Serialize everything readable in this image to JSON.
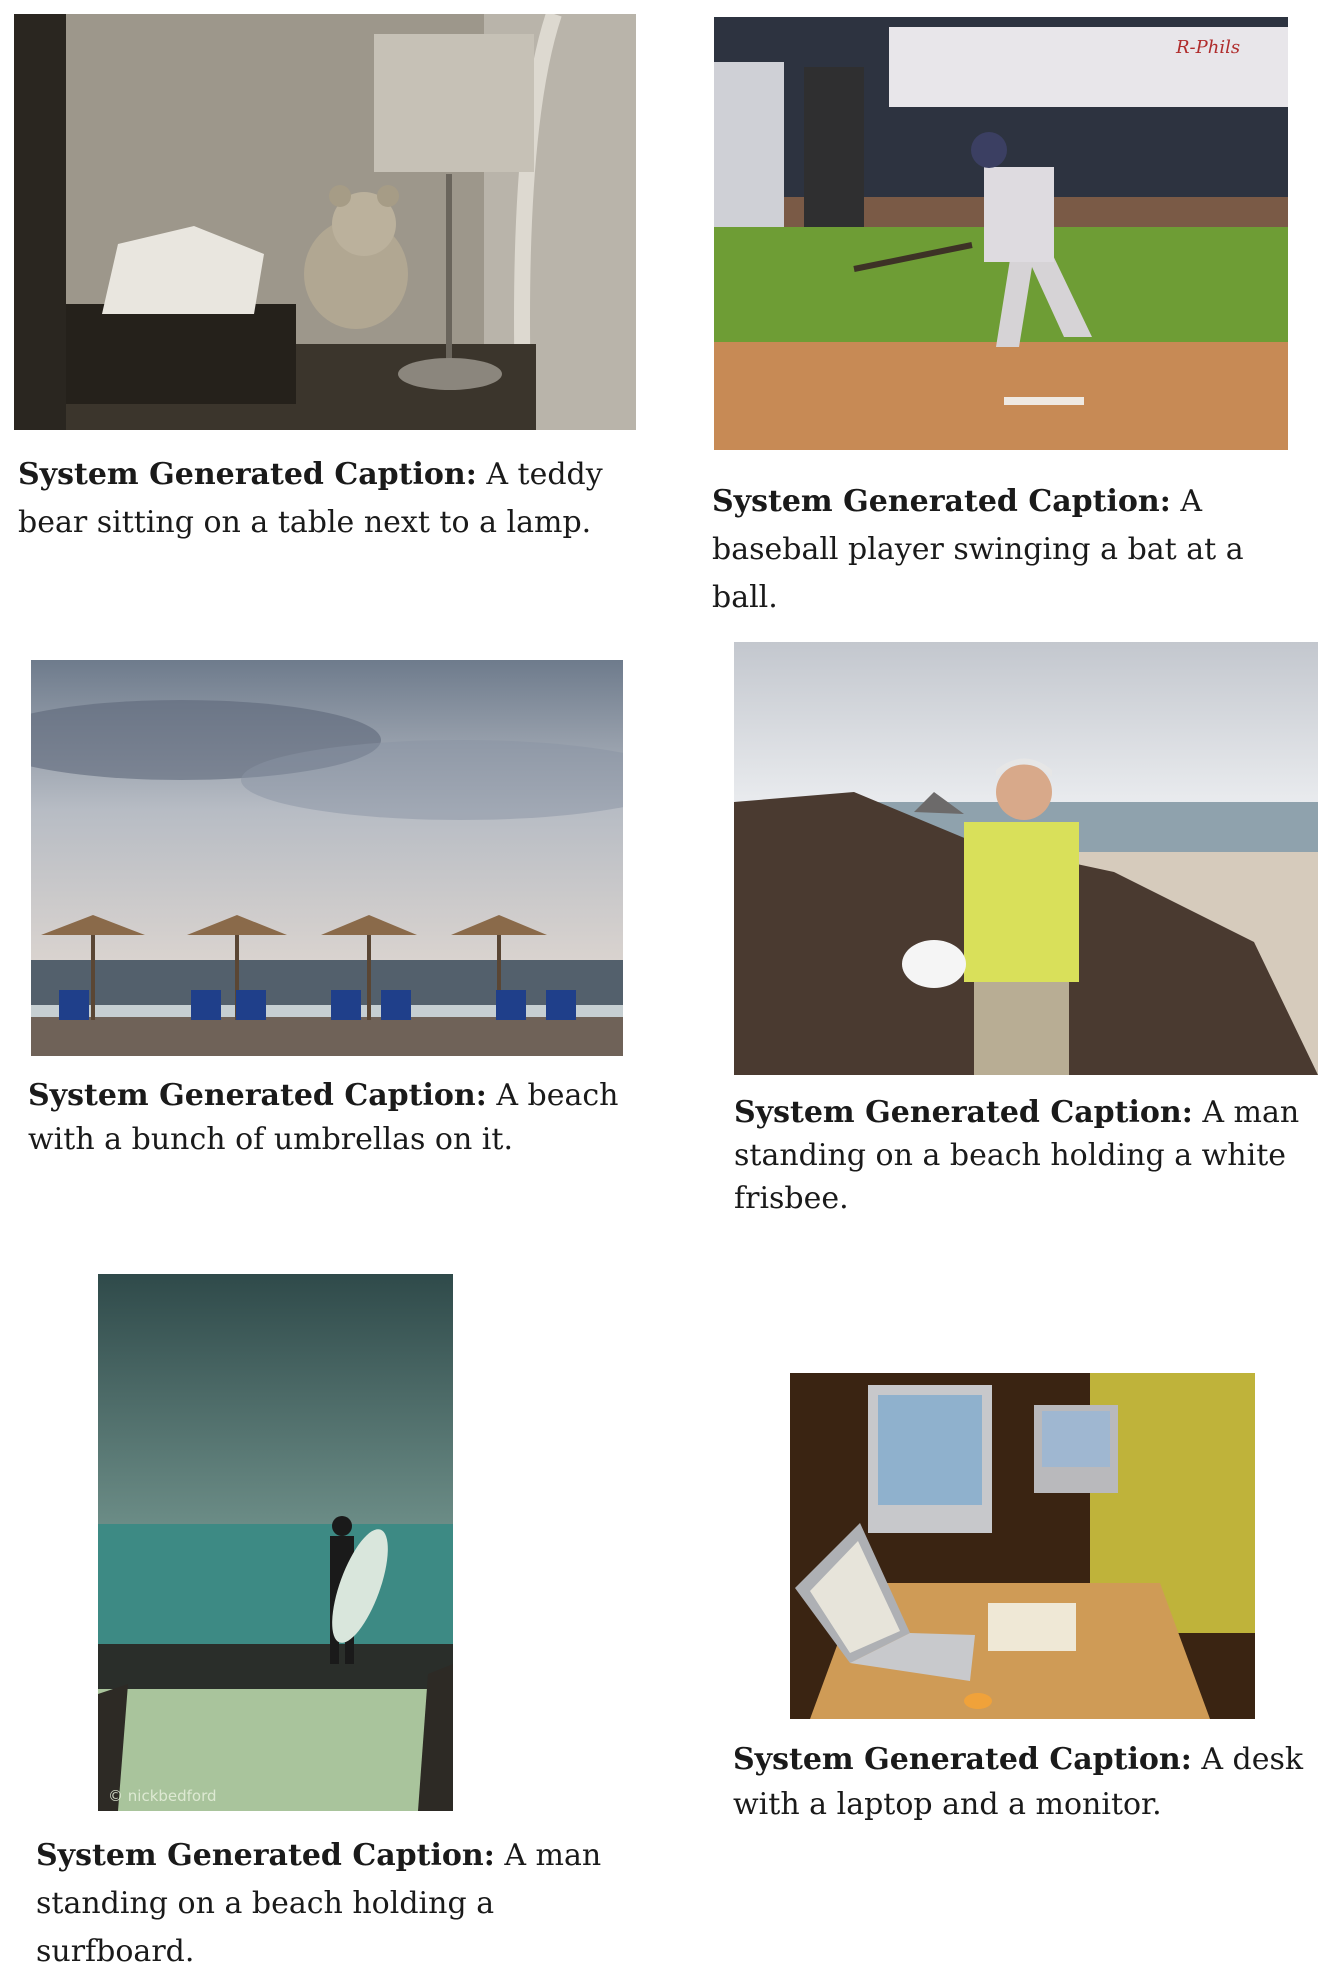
{
  "panels": [
    {
      "caption_label": "System Generated Caption:",
      "caption_text": "A teddy bear sitting on a table next to a lamp.",
      "photo_icon": "teddy-bear-lamp-photo"
    },
    {
      "caption_label": "System Generated Caption:",
      "caption_text": "A baseball player swinging a bat at a ball.",
      "photo_icon": "baseball-batter-photo",
      "banner_text": "R-Phils"
    },
    {
      "caption_label": "System Generated Caption:",
      "caption_text": "A beach with a bunch of umbrellas on it.",
      "photo_icon": "beach-umbrellas-photo"
    },
    {
      "caption_label": "System Generated Caption:",
      "caption_text": "A man standing on a beach holding a white frisbee.",
      "photo_icon": "man-frisbee-photo"
    },
    {
      "caption_label": "System Generated Caption:",
      "caption_text": "A man standing on a beach holding a surfboard.",
      "photo_icon": "surfer-beach-photo",
      "watermark": "© nickbedford"
    },
    {
      "caption_label": "System Generated Caption:",
      "caption_text": "A desk with a laptop and a monitor.",
      "photo_icon": "desk-laptop-monitor-photo"
    }
  ]
}
